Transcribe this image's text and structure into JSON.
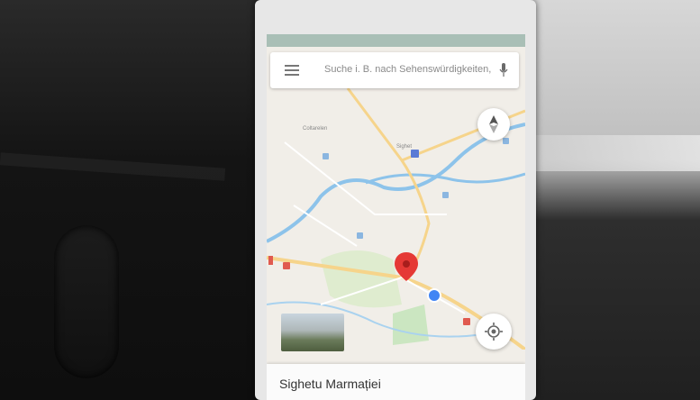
{
  "search": {
    "placeholder": "Suche i. B. nach Sehenswürdigkeiten, G..."
  },
  "place": {
    "title": "Sighetu Marmației"
  },
  "map": {
    "labels": [
      "Coltarelen",
      "Sighet"
    ]
  },
  "colors": {
    "pin": "#e53935",
    "water": "#8dc3ea",
    "road_major": "#f6d48b",
    "road_minor": "#ffffff",
    "park": "#cbe6c1",
    "my_location": "#4285f4"
  },
  "icons": {
    "menu": "menu-icon",
    "mic": "mic-icon",
    "compass": "compass-icon",
    "my_location": "my-location-icon",
    "pin": "map-pin-icon"
  }
}
